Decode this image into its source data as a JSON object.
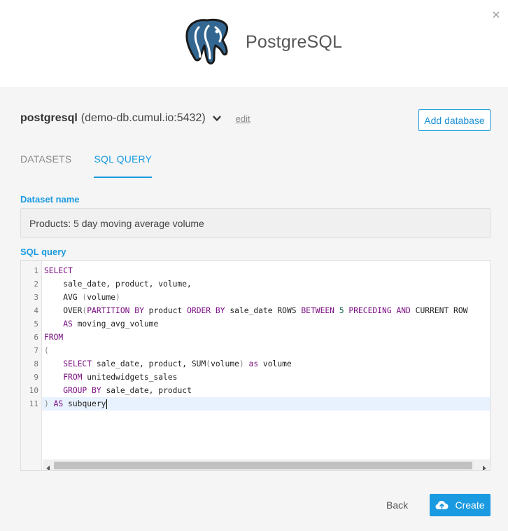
{
  "header": {
    "brand": "PostgreSQL",
    "logo_icon": "postgresql-elephant-logo",
    "close_icon": "close-icon"
  },
  "connection": {
    "name": "postgresql",
    "host": "(demo-db.cumul.io:5432)",
    "edit_label": "edit",
    "add_button": "Add database"
  },
  "tabs": [
    {
      "label": "DATASETS",
      "active": false
    },
    {
      "label": "SQL QUERY",
      "active": true
    }
  ],
  "dataset": {
    "label": "Dataset name",
    "value": "Products: 5 day moving average volume"
  },
  "sql": {
    "label": "SQL query",
    "active_line": 11,
    "line_numbers": [
      "1",
      "2",
      "3",
      "4",
      "5",
      "6",
      "7",
      "8",
      "9",
      "10",
      "11"
    ],
    "lines": [
      "SELECT",
      "    sale_date, product, volume,",
      "    AVG (volume)",
      "    OVER(PARTITION BY product ORDER BY sale_date ROWS BETWEEN 5 PRECEDING AND CURRENT ROW",
      "    AS moving_avg_volume",
      "FROM",
      "(",
      "    SELECT sale_date, product, SUM(volume) as volume",
      "    FROM unitedwidgets_sales",
      "    GROUP BY sale_date, product",
      ") AS subquery"
    ]
  },
  "footer": {
    "back": "Back",
    "create": "Create"
  },
  "colors": {
    "accent": "#1a9ae0",
    "keyword": "#7a0e82",
    "active_line": "#e8f2fe"
  }
}
